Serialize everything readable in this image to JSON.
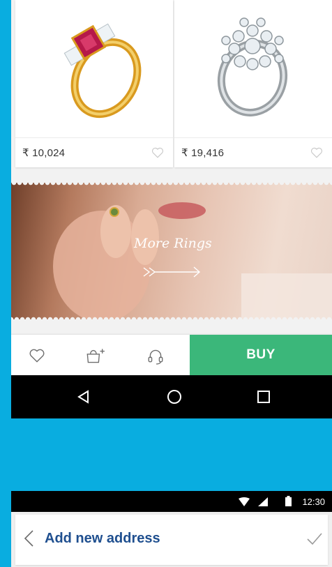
{
  "products": [
    {
      "name": "ruby-princess-cut-gold-ring",
      "price": "₹ 10,024",
      "wishlist_icon": "heart-outline-icon"
    },
    {
      "name": "diamond-cluster-white-gold-ring",
      "price": "₹ 19,416",
      "wishlist_icon": "heart-outline-icon"
    }
  ],
  "banner": {
    "text": "More Rings",
    "icon": "arrow-right-icon"
  },
  "action_bar": {
    "wishlist_icon": "heart-outline-icon",
    "add_to_bag_icon": "bag-plus-icon",
    "support_icon": "headset-icon",
    "buy_label": "BUY",
    "buy_color": "#3bb77a"
  },
  "nav_bar": {
    "back": "back-triangle-icon",
    "home": "home-circle-icon",
    "recents": "recents-square-icon"
  },
  "status_bar": {
    "time": "12:30",
    "icons": [
      "wifi-icon",
      "signal-icon",
      "battery-icon"
    ]
  },
  "address_screen": {
    "title": "Add new address",
    "back_icon": "chevron-left-icon",
    "confirm_icon": "check-icon"
  },
  "colors": {
    "background": "#09ade0",
    "title": "#1f4f8f"
  }
}
